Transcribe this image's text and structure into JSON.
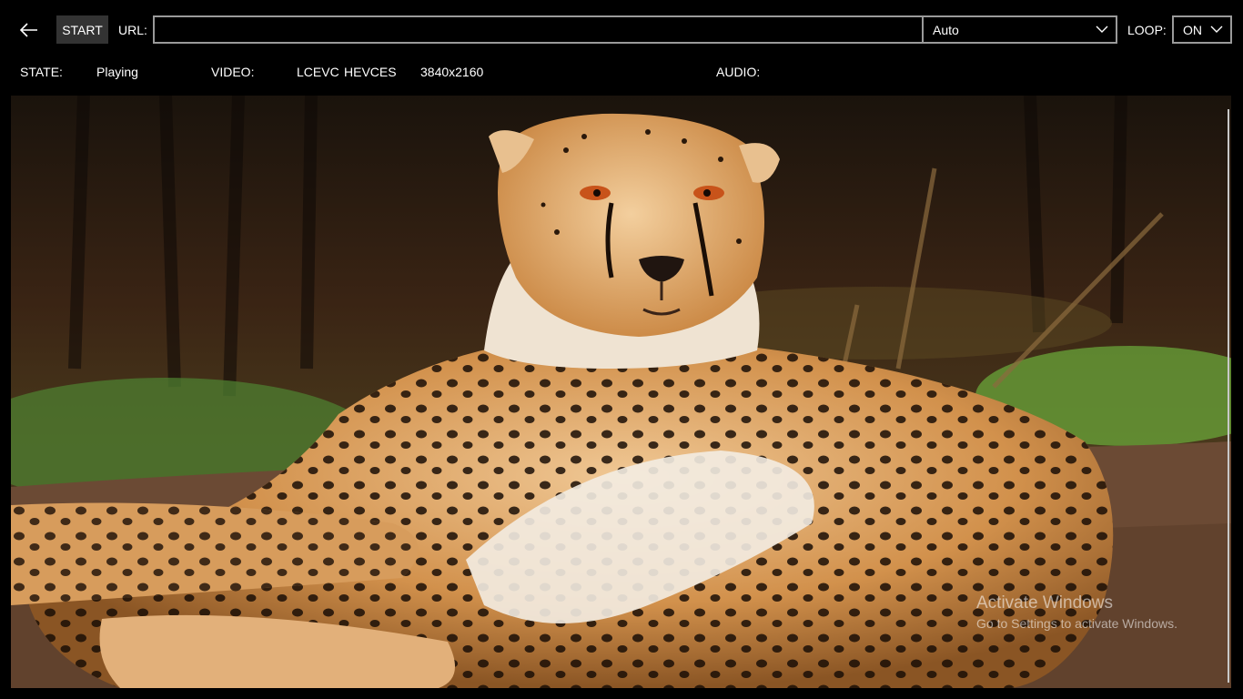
{
  "toolbar": {
    "back_icon": "arrow-left-icon",
    "start_label": "START",
    "url_label": "URL:",
    "url_value": "",
    "quality_select": {
      "selected": "Auto"
    },
    "loop_label": "LOOP:",
    "loop_select": {
      "selected": "ON"
    }
  },
  "status": {
    "state_label": "STATE:",
    "state_value": "Playing",
    "video_label": "VIDEO:",
    "video_codec_1": "LCEVC",
    "video_codec_2": "HEVCES",
    "video_resolution": "3840x2160",
    "audio_label": "AUDIO:",
    "audio_value": ""
  },
  "player": {
    "content": "cheetah lying on ground video frame"
  },
  "watermark": {
    "title": "Activate Windows",
    "subtitle": "Go to Settings to activate Windows."
  },
  "colors": {
    "background": "#000000",
    "button_bg": "#333333",
    "field_border": "#9a9a9a"
  }
}
